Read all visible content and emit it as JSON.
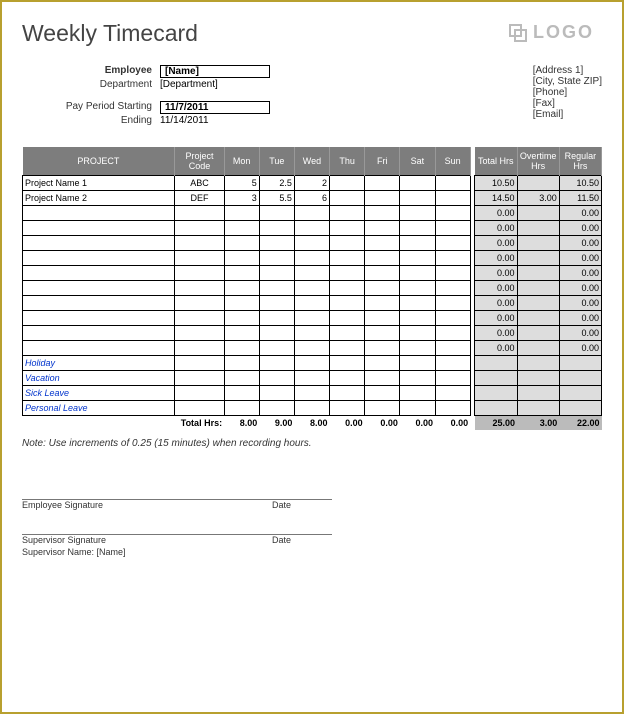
{
  "title": "Weekly Timecard",
  "logo_text": "LOGO",
  "employee_info": {
    "employee_label": "Employee",
    "employee_value": "[Name]",
    "department_label": "Department",
    "department_value": "[Department]",
    "start_label": "Pay Period Starting",
    "start_value": "11/7/2011",
    "end_label": "Ending",
    "end_value": "11/14/2011"
  },
  "company_info": {
    "address1": "[Address 1]",
    "citystatezip": "[City, State ZIP]",
    "phone": "[Phone]",
    "fax": "[Fax]",
    "email": "[Email]"
  },
  "headers": {
    "project": "PROJECT",
    "code": "Project Code",
    "days": [
      "Mon",
      "Tue",
      "Wed",
      "Thu",
      "Fri",
      "Sat",
      "Sun"
    ],
    "total": "Total Hrs",
    "overtime": "Overtime Hrs",
    "regular": "Regular Hrs"
  },
  "rows": [
    {
      "name": "Project Name 1",
      "code": "ABC",
      "days": [
        "5",
        "2.5",
        "2",
        "",
        "",
        "",
        ""
      ],
      "total": "10.50",
      "overtime": "",
      "regular": "10.50"
    },
    {
      "name": "Project Name 2",
      "code": "DEF",
      "days": [
        "3",
        "5.5",
        "6",
        "",
        "",
        "",
        ""
      ],
      "total": "14.50",
      "overtime": "3.00",
      "regular": "11.50"
    },
    {
      "name": "",
      "code": "",
      "days": [
        "",
        "",
        "",
        "",
        "",
        "",
        ""
      ],
      "total": "0.00",
      "overtime": "",
      "regular": "0.00"
    },
    {
      "name": "",
      "code": "",
      "days": [
        "",
        "",
        "",
        "",
        "",
        "",
        ""
      ],
      "total": "0.00",
      "overtime": "",
      "regular": "0.00"
    },
    {
      "name": "",
      "code": "",
      "days": [
        "",
        "",
        "",
        "",
        "",
        "",
        ""
      ],
      "total": "0.00",
      "overtime": "",
      "regular": "0.00"
    },
    {
      "name": "",
      "code": "",
      "days": [
        "",
        "",
        "",
        "",
        "",
        "",
        ""
      ],
      "total": "0.00",
      "overtime": "",
      "regular": "0.00"
    },
    {
      "name": "",
      "code": "",
      "days": [
        "",
        "",
        "",
        "",
        "",
        "",
        ""
      ],
      "total": "0.00",
      "overtime": "",
      "regular": "0.00"
    },
    {
      "name": "",
      "code": "",
      "days": [
        "",
        "",
        "",
        "",
        "",
        "",
        ""
      ],
      "total": "0.00",
      "overtime": "",
      "regular": "0.00"
    },
    {
      "name": "",
      "code": "",
      "days": [
        "",
        "",
        "",
        "",
        "",
        "",
        ""
      ],
      "total": "0.00",
      "overtime": "",
      "regular": "0.00"
    },
    {
      "name": "",
      "code": "",
      "days": [
        "",
        "",
        "",
        "",
        "",
        "",
        ""
      ],
      "total": "0.00",
      "overtime": "",
      "regular": "0.00"
    },
    {
      "name": "",
      "code": "",
      "days": [
        "",
        "",
        "",
        "",
        "",
        "",
        ""
      ],
      "total": "0.00",
      "overtime": "",
      "regular": "0.00"
    },
    {
      "name": "",
      "code": "",
      "days": [
        "",
        "",
        "",
        "",
        "",
        "",
        ""
      ],
      "total": "0.00",
      "overtime": "",
      "regular": "0.00"
    }
  ],
  "category_rows": [
    {
      "name": "Holiday"
    },
    {
      "name": "Vacation"
    },
    {
      "name": "Sick Leave"
    },
    {
      "name": "Personal Leave"
    }
  ],
  "totals": {
    "label": "Total Hrs:",
    "days": [
      "8.00",
      "9.00",
      "8.00",
      "0.00",
      "0.00",
      "0.00",
      "0.00"
    ],
    "total": "25.00",
    "overtime": "3.00",
    "regular": "22.00"
  },
  "note": "Note: Use increments of 0.25 (15 minutes) when recording hours.",
  "signatures": {
    "emp_sig": "Employee Signature",
    "sup_sig": "Supervisor Signature",
    "date": "Date",
    "sup_name_label": "Supervisor Name:",
    "sup_name_value": "[Name]"
  }
}
